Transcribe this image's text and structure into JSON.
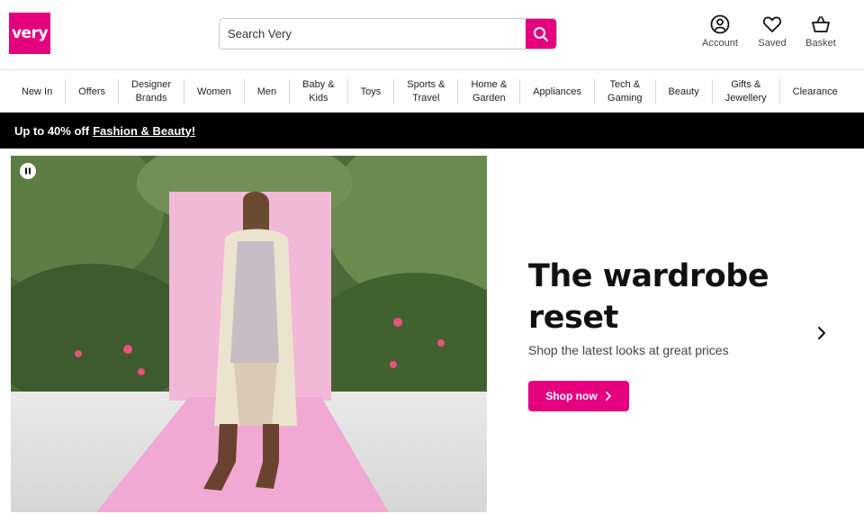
{
  "brand": {
    "logo_text": "very",
    "accent": "#e5007e"
  },
  "search": {
    "placeholder": "Search Very",
    "icon": "search-icon"
  },
  "utility": [
    {
      "label": "Account",
      "icon": "account-icon"
    },
    {
      "label": "Saved",
      "icon": "heart-icon"
    },
    {
      "label": "Basket",
      "icon": "basket-icon"
    }
  ],
  "nav": [
    "New In",
    "Offers",
    "Designer\nBrands",
    "Women",
    "Men",
    "Baby &\nKids",
    "Toys",
    "Sports &\nTravel",
    "Home &\nGarden",
    "Appliances",
    "Tech &\nGaming",
    "Beauty",
    "Gifts &\nJewellery",
    "Clearance"
  ],
  "promo": {
    "prefix": "Up to 40% off",
    "link": "Fashion & Beauty!"
  },
  "hero": {
    "title": "The wardrobe reset",
    "subtitle": "Shop the latest looks at great prices",
    "cta": "Shop now"
  }
}
